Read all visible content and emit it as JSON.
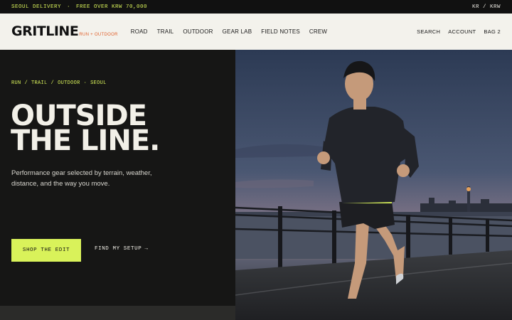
{
  "topbar": {
    "delivery": "SEOUL DELIVERY",
    "separator": "·",
    "shipping": "FREE OVER KRW 70,000",
    "locale": "KR / KRW"
  },
  "brand": {
    "logo": "GRITLINE",
    "tagline": "RUN + OUTDOOR",
    "accent_color": "#e0602b"
  },
  "nav": {
    "items": [
      "ROAD",
      "TRAIL",
      "OUTDOOR",
      "GEAR LAB",
      "FIELD NOTES",
      "CREW"
    ],
    "search": "SEARCH",
    "account": "ACCOUNT",
    "bag": "BAG 2"
  },
  "hero": {
    "breadcrumb": [
      "RUN",
      "/",
      "TRAIL",
      "/",
      "OUTDOOR",
      "·",
      "SEOUL"
    ],
    "headline_line1": "OUTSIDE",
    "headline_line2": "THE LINE.",
    "description": "Performance gear selected by terrain, weather, distance, and the way you move.",
    "cta_primary": "SHOP THE EDIT",
    "cta_secondary": "FIND MY SETUP",
    "cta_secondary_arrow": "→",
    "highlight_color": "#d9f25a"
  }
}
